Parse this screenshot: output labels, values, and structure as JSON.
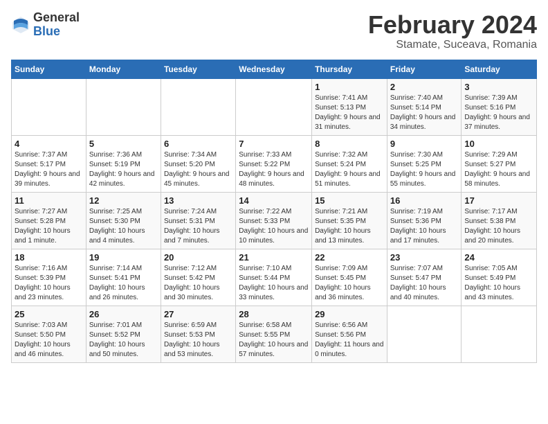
{
  "header": {
    "logo_general": "General",
    "logo_blue": "Blue",
    "title": "February 2024",
    "subtitle": "Stamate, Suceava, Romania"
  },
  "columns": [
    "Sunday",
    "Monday",
    "Tuesday",
    "Wednesday",
    "Thursday",
    "Friday",
    "Saturday"
  ],
  "weeks": [
    [
      {
        "day": "",
        "sunrise": "",
        "sunset": "",
        "daylight": ""
      },
      {
        "day": "",
        "sunrise": "",
        "sunset": "",
        "daylight": ""
      },
      {
        "day": "",
        "sunrise": "",
        "sunset": "",
        "daylight": ""
      },
      {
        "day": "",
        "sunrise": "",
        "sunset": "",
        "daylight": ""
      },
      {
        "day": "1",
        "sunrise": "Sunrise: 7:41 AM",
        "sunset": "Sunset: 5:13 PM",
        "daylight": "Daylight: 9 hours and 31 minutes."
      },
      {
        "day": "2",
        "sunrise": "Sunrise: 7:40 AM",
        "sunset": "Sunset: 5:14 PM",
        "daylight": "Daylight: 9 hours and 34 minutes."
      },
      {
        "day": "3",
        "sunrise": "Sunrise: 7:39 AM",
        "sunset": "Sunset: 5:16 PM",
        "daylight": "Daylight: 9 hours and 37 minutes."
      }
    ],
    [
      {
        "day": "4",
        "sunrise": "Sunrise: 7:37 AM",
        "sunset": "Sunset: 5:17 PM",
        "daylight": "Daylight: 9 hours and 39 minutes."
      },
      {
        "day": "5",
        "sunrise": "Sunrise: 7:36 AM",
        "sunset": "Sunset: 5:19 PM",
        "daylight": "Daylight: 9 hours and 42 minutes."
      },
      {
        "day": "6",
        "sunrise": "Sunrise: 7:34 AM",
        "sunset": "Sunset: 5:20 PM",
        "daylight": "Daylight: 9 hours and 45 minutes."
      },
      {
        "day": "7",
        "sunrise": "Sunrise: 7:33 AM",
        "sunset": "Sunset: 5:22 PM",
        "daylight": "Daylight: 9 hours and 48 minutes."
      },
      {
        "day": "8",
        "sunrise": "Sunrise: 7:32 AM",
        "sunset": "Sunset: 5:24 PM",
        "daylight": "Daylight: 9 hours and 51 minutes."
      },
      {
        "day": "9",
        "sunrise": "Sunrise: 7:30 AM",
        "sunset": "Sunset: 5:25 PM",
        "daylight": "Daylight: 9 hours and 55 minutes."
      },
      {
        "day": "10",
        "sunrise": "Sunrise: 7:29 AM",
        "sunset": "Sunset: 5:27 PM",
        "daylight": "Daylight: 9 hours and 58 minutes."
      }
    ],
    [
      {
        "day": "11",
        "sunrise": "Sunrise: 7:27 AM",
        "sunset": "Sunset: 5:28 PM",
        "daylight": "Daylight: 10 hours and 1 minute."
      },
      {
        "day": "12",
        "sunrise": "Sunrise: 7:25 AM",
        "sunset": "Sunset: 5:30 PM",
        "daylight": "Daylight: 10 hours and 4 minutes."
      },
      {
        "day": "13",
        "sunrise": "Sunrise: 7:24 AM",
        "sunset": "Sunset: 5:31 PM",
        "daylight": "Daylight: 10 hours and 7 minutes."
      },
      {
        "day": "14",
        "sunrise": "Sunrise: 7:22 AM",
        "sunset": "Sunset: 5:33 PM",
        "daylight": "Daylight: 10 hours and 10 minutes."
      },
      {
        "day": "15",
        "sunrise": "Sunrise: 7:21 AM",
        "sunset": "Sunset: 5:35 PM",
        "daylight": "Daylight: 10 hours and 13 minutes."
      },
      {
        "day": "16",
        "sunrise": "Sunrise: 7:19 AM",
        "sunset": "Sunset: 5:36 PM",
        "daylight": "Daylight: 10 hours and 17 minutes."
      },
      {
        "day": "17",
        "sunrise": "Sunrise: 7:17 AM",
        "sunset": "Sunset: 5:38 PM",
        "daylight": "Daylight: 10 hours and 20 minutes."
      }
    ],
    [
      {
        "day": "18",
        "sunrise": "Sunrise: 7:16 AM",
        "sunset": "Sunset: 5:39 PM",
        "daylight": "Daylight: 10 hours and 23 minutes."
      },
      {
        "day": "19",
        "sunrise": "Sunrise: 7:14 AM",
        "sunset": "Sunset: 5:41 PM",
        "daylight": "Daylight: 10 hours and 26 minutes."
      },
      {
        "day": "20",
        "sunrise": "Sunrise: 7:12 AM",
        "sunset": "Sunset: 5:42 PM",
        "daylight": "Daylight: 10 hours and 30 minutes."
      },
      {
        "day": "21",
        "sunrise": "Sunrise: 7:10 AM",
        "sunset": "Sunset: 5:44 PM",
        "daylight": "Daylight: 10 hours and 33 minutes."
      },
      {
        "day": "22",
        "sunrise": "Sunrise: 7:09 AM",
        "sunset": "Sunset: 5:45 PM",
        "daylight": "Daylight: 10 hours and 36 minutes."
      },
      {
        "day": "23",
        "sunrise": "Sunrise: 7:07 AM",
        "sunset": "Sunset: 5:47 PM",
        "daylight": "Daylight: 10 hours and 40 minutes."
      },
      {
        "day": "24",
        "sunrise": "Sunrise: 7:05 AM",
        "sunset": "Sunset: 5:49 PM",
        "daylight": "Daylight: 10 hours and 43 minutes."
      }
    ],
    [
      {
        "day": "25",
        "sunrise": "Sunrise: 7:03 AM",
        "sunset": "Sunset: 5:50 PM",
        "daylight": "Daylight: 10 hours and 46 minutes."
      },
      {
        "day": "26",
        "sunrise": "Sunrise: 7:01 AM",
        "sunset": "Sunset: 5:52 PM",
        "daylight": "Daylight: 10 hours and 50 minutes."
      },
      {
        "day": "27",
        "sunrise": "Sunrise: 6:59 AM",
        "sunset": "Sunset: 5:53 PM",
        "daylight": "Daylight: 10 hours and 53 minutes."
      },
      {
        "day": "28",
        "sunrise": "Sunrise: 6:58 AM",
        "sunset": "Sunset: 5:55 PM",
        "daylight": "Daylight: 10 hours and 57 minutes."
      },
      {
        "day": "29",
        "sunrise": "Sunrise: 6:56 AM",
        "sunset": "Sunset: 5:56 PM",
        "daylight": "Daylight: 11 hours and 0 minutes."
      },
      {
        "day": "",
        "sunrise": "",
        "sunset": "",
        "daylight": ""
      },
      {
        "day": "",
        "sunrise": "",
        "sunset": "",
        "daylight": ""
      }
    ]
  ]
}
